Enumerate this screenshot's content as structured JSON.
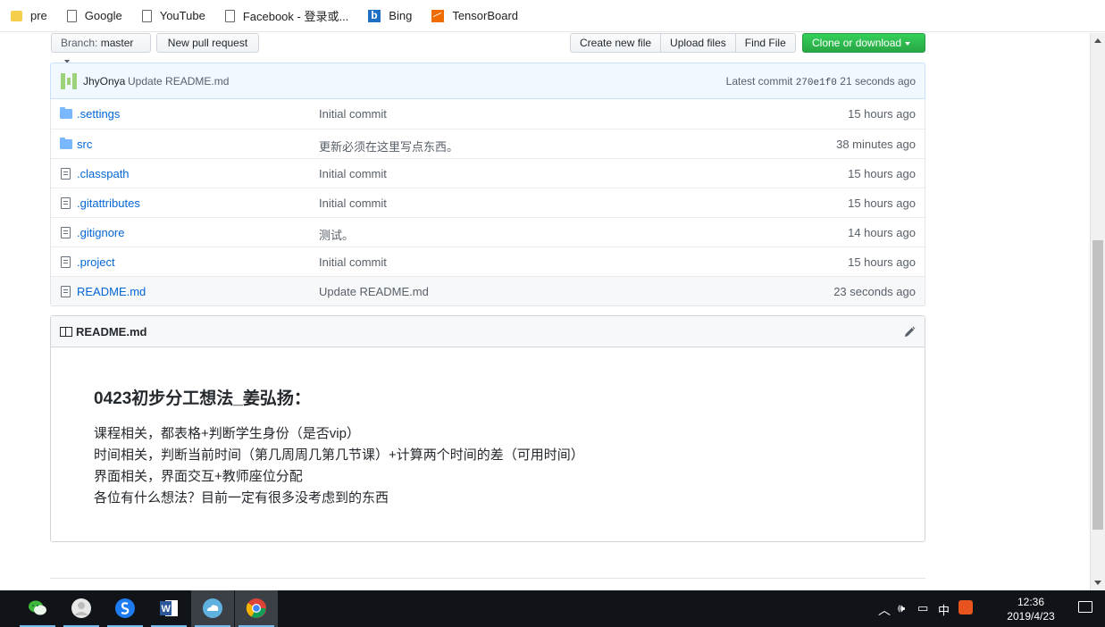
{
  "bookmarks": [
    {
      "label": "pre",
      "icon": "folder-icon"
    },
    {
      "label": "Google",
      "icon": "page-icon"
    },
    {
      "label": "YouTube",
      "icon": "page-icon"
    },
    {
      "label": "Facebook - 登录或...",
      "icon": "page-icon"
    },
    {
      "label": "Bing",
      "icon": "bing-icon"
    },
    {
      "label": "TensorBoard",
      "icon": "tensorboard-icon"
    }
  ],
  "toolbar": {
    "branch_prefix": "Branch:",
    "branch_name": "master",
    "new_pull_request": "New pull request",
    "create_new_file": "Create new file",
    "upload_files": "Upload files",
    "find_file": "Find File",
    "clone_or_download": "Clone or download"
  },
  "latest_commit": {
    "author": "JhyOnya",
    "message": "Update README.md",
    "label": "Latest commit",
    "sha": "270e1f0",
    "age": "21 seconds ago"
  },
  "files": [
    {
      "name": ".settings",
      "type": "dir",
      "message": "Initial commit",
      "age": "15 hours ago"
    },
    {
      "name": "src",
      "type": "dir",
      "message": "更新必须在这里写点东西。",
      "age": "38 minutes ago"
    },
    {
      "name": ".classpath",
      "type": "file",
      "message": "Initial commit",
      "age": "15 hours ago"
    },
    {
      "name": ".gitattributes",
      "type": "file",
      "message": "Initial commit",
      "age": "15 hours ago"
    },
    {
      "name": ".gitignore",
      "type": "file",
      "message": "测试。",
      "age": "14 hours ago"
    },
    {
      "name": ".project",
      "type": "file",
      "message": "Initial commit",
      "age": "15 hours ago"
    },
    {
      "name": "README.md",
      "type": "file",
      "message": "Update README.md",
      "age": "23 seconds ago"
    }
  ],
  "readme": {
    "title": "README.md",
    "heading": "0423初步分工想法_姜弘扬：",
    "lines": [
      "课程相关，都表格+判断学生身份（是否vip）",
      "时间相关，判断当前时间（第几周周几第几节课）+计算两个时间的差（可用时间）",
      "界面相关，界面交互+教师座位分配",
      "各位有什么想法？目前一定有很多没考虑到的东西"
    ]
  },
  "taskbar": {
    "apps": [
      "file-explorer-icon",
      "wechat-icon",
      "contacts-icon",
      "sogou-browser-icon",
      "word-icon",
      "cloud-icon",
      "chrome-icon"
    ],
    "tray_ime": "中",
    "time": "12:36",
    "date": "2019/4/23"
  }
}
